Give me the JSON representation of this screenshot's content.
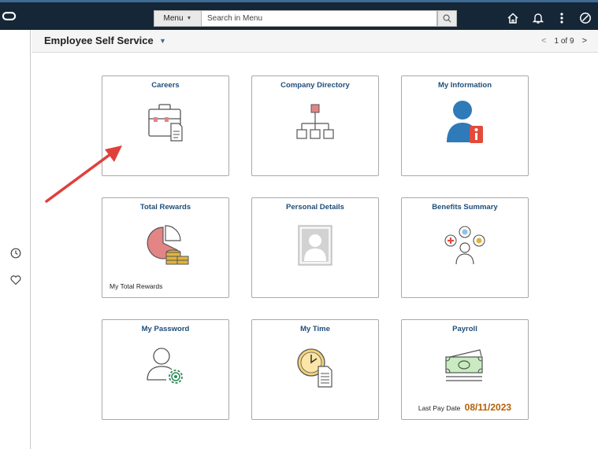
{
  "topbar": {
    "menu_label": "Menu",
    "search_placeholder": "Search in Menu",
    "icons": [
      "oracle-logo-icon",
      "search-icon",
      "home-icon",
      "bell-icon",
      "more-vertical-icon",
      "navbar-compass-icon"
    ]
  },
  "header": {
    "title": "Employee Self Service",
    "pager": "1 of 9"
  },
  "rail": {
    "icons": [
      "recent-history-icon",
      "favorites-heart-icon"
    ]
  },
  "tiles": {
    "careers": {
      "title": "Careers"
    },
    "company_directory": {
      "title": "Company Directory"
    },
    "my_information": {
      "title": "My Information"
    },
    "total_rewards": {
      "title": "Total Rewards",
      "footer": "My Total Rewards"
    },
    "personal_details": {
      "title": "Personal Details"
    },
    "benefits_summary": {
      "title": "Benefits Summary"
    },
    "my_password": {
      "title": "My Password"
    },
    "my_time": {
      "title": "My Time"
    },
    "payroll": {
      "title": "Payroll",
      "footer_label": "Last Pay Date",
      "footer_value": "08/11/2023"
    }
  },
  "colors": {
    "topbar_bg": "#152636",
    "tile_title": "#1e4e79",
    "annotation_arrow": "#e0403c",
    "pay_date": "#b45f06"
  }
}
